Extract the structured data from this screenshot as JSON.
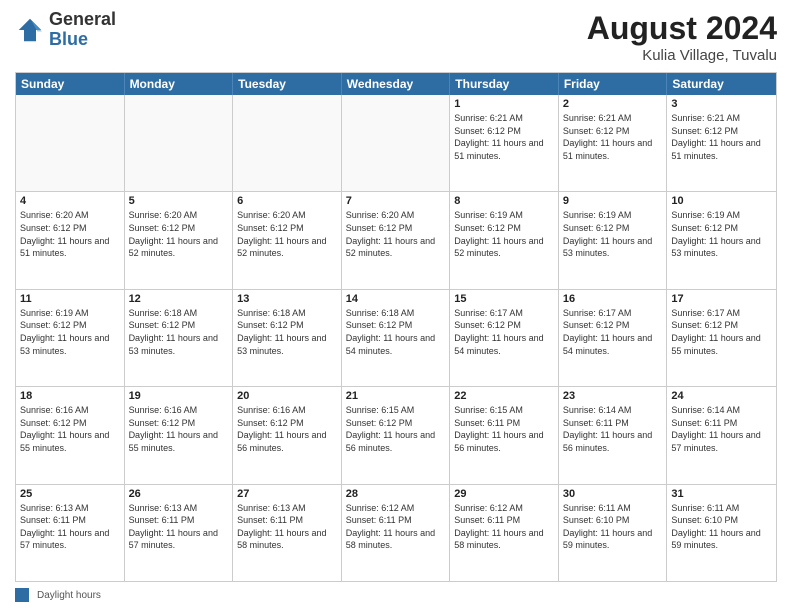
{
  "logo": {
    "general": "General",
    "blue": "Blue"
  },
  "title": "August 2024",
  "subtitle": "Kulia Village, Tuvalu",
  "days_of_week": [
    "Sunday",
    "Monday",
    "Tuesday",
    "Wednesday",
    "Thursday",
    "Friday",
    "Saturday"
  ],
  "weeks": [
    [
      {
        "day": "",
        "sunrise": "",
        "sunset": "",
        "daylight": "",
        "empty": true
      },
      {
        "day": "",
        "sunrise": "",
        "sunset": "",
        "daylight": "",
        "empty": true
      },
      {
        "day": "",
        "sunrise": "",
        "sunset": "",
        "daylight": "",
        "empty": true
      },
      {
        "day": "",
        "sunrise": "",
        "sunset": "",
        "daylight": "",
        "empty": true
      },
      {
        "day": "1",
        "sunrise": "Sunrise: 6:21 AM",
        "sunset": "Sunset: 6:12 PM",
        "daylight": "Daylight: 11 hours and 51 minutes.",
        "empty": false
      },
      {
        "day": "2",
        "sunrise": "Sunrise: 6:21 AM",
        "sunset": "Sunset: 6:12 PM",
        "daylight": "Daylight: 11 hours and 51 minutes.",
        "empty": false
      },
      {
        "day": "3",
        "sunrise": "Sunrise: 6:21 AM",
        "sunset": "Sunset: 6:12 PM",
        "daylight": "Daylight: 11 hours and 51 minutes.",
        "empty": false
      }
    ],
    [
      {
        "day": "4",
        "sunrise": "Sunrise: 6:20 AM",
        "sunset": "Sunset: 6:12 PM",
        "daylight": "Daylight: 11 hours and 51 minutes.",
        "empty": false
      },
      {
        "day": "5",
        "sunrise": "Sunrise: 6:20 AM",
        "sunset": "Sunset: 6:12 PM",
        "daylight": "Daylight: 11 hours and 52 minutes.",
        "empty": false
      },
      {
        "day": "6",
        "sunrise": "Sunrise: 6:20 AM",
        "sunset": "Sunset: 6:12 PM",
        "daylight": "Daylight: 11 hours and 52 minutes.",
        "empty": false
      },
      {
        "day": "7",
        "sunrise": "Sunrise: 6:20 AM",
        "sunset": "Sunset: 6:12 PM",
        "daylight": "Daylight: 11 hours and 52 minutes.",
        "empty": false
      },
      {
        "day": "8",
        "sunrise": "Sunrise: 6:19 AM",
        "sunset": "Sunset: 6:12 PM",
        "daylight": "Daylight: 11 hours and 52 minutes.",
        "empty": false
      },
      {
        "day": "9",
        "sunrise": "Sunrise: 6:19 AM",
        "sunset": "Sunset: 6:12 PM",
        "daylight": "Daylight: 11 hours and 53 minutes.",
        "empty": false
      },
      {
        "day": "10",
        "sunrise": "Sunrise: 6:19 AM",
        "sunset": "Sunset: 6:12 PM",
        "daylight": "Daylight: 11 hours and 53 minutes.",
        "empty": false
      }
    ],
    [
      {
        "day": "11",
        "sunrise": "Sunrise: 6:19 AM",
        "sunset": "Sunset: 6:12 PM",
        "daylight": "Daylight: 11 hours and 53 minutes.",
        "empty": false
      },
      {
        "day": "12",
        "sunrise": "Sunrise: 6:18 AM",
        "sunset": "Sunset: 6:12 PM",
        "daylight": "Daylight: 11 hours and 53 minutes.",
        "empty": false
      },
      {
        "day": "13",
        "sunrise": "Sunrise: 6:18 AM",
        "sunset": "Sunset: 6:12 PM",
        "daylight": "Daylight: 11 hours and 53 minutes.",
        "empty": false
      },
      {
        "day": "14",
        "sunrise": "Sunrise: 6:18 AM",
        "sunset": "Sunset: 6:12 PM",
        "daylight": "Daylight: 11 hours and 54 minutes.",
        "empty": false
      },
      {
        "day": "15",
        "sunrise": "Sunrise: 6:17 AM",
        "sunset": "Sunset: 6:12 PM",
        "daylight": "Daylight: 11 hours and 54 minutes.",
        "empty": false
      },
      {
        "day": "16",
        "sunrise": "Sunrise: 6:17 AM",
        "sunset": "Sunset: 6:12 PM",
        "daylight": "Daylight: 11 hours and 54 minutes.",
        "empty": false
      },
      {
        "day": "17",
        "sunrise": "Sunrise: 6:17 AM",
        "sunset": "Sunset: 6:12 PM",
        "daylight": "Daylight: 11 hours and 55 minutes.",
        "empty": false
      }
    ],
    [
      {
        "day": "18",
        "sunrise": "Sunrise: 6:16 AM",
        "sunset": "Sunset: 6:12 PM",
        "daylight": "Daylight: 11 hours and 55 minutes.",
        "empty": false
      },
      {
        "day": "19",
        "sunrise": "Sunrise: 6:16 AM",
        "sunset": "Sunset: 6:12 PM",
        "daylight": "Daylight: 11 hours and 55 minutes.",
        "empty": false
      },
      {
        "day": "20",
        "sunrise": "Sunrise: 6:16 AM",
        "sunset": "Sunset: 6:12 PM",
        "daylight": "Daylight: 11 hours and 56 minutes.",
        "empty": false
      },
      {
        "day": "21",
        "sunrise": "Sunrise: 6:15 AM",
        "sunset": "Sunset: 6:12 PM",
        "daylight": "Daylight: 11 hours and 56 minutes.",
        "empty": false
      },
      {
        "day": "22",
        "sunrise": "Sunrise: 6:15 AM",
        "sunset": "Sunset: 6:11 PM",
        "daylight": "Daylight: 11 hours and 56 minutes.",
        "empty": false
      },
      {
        "day": "23",
        "sunrise": "Sunrise: 6:14 AM",
        "sunset": "Sunset: 6:11 PM",
        "daylight": "Daylight: 11 hours and 56 minutes.",
        "empty": false
      },
      {
        "day": "24",
        "sunrise": "Sunrise: 6:14 AM",
        "sunset": "Sunset: 6:11 PM",
        "daylight": "Daylight: 11 hours and 57 minutes.",
        "empty": false
      }
    ],
    [
      {
        "day": "25",
        "sunrise": "Sunrise: 6:13 AM",
        "sunset": "Sunset: 6:11 PM",
        "daylight": "Daylight: 11 hours and 57 minutes.",
        "empty": false
      },
      {
        "day": "26",
        "sunrise": "Sunrise: 6:13 AM",
        "sunset": "Sunset: 6:11 PM",
        "daylight": "Daylight: 11 hours and 57 minutes.",
        "empty": false
      },
      {
        "day": "27",
        "sunrise": "Sunrise: 6:13 AM",
        "sunset": "Sunset: 6:11 PM",
        "daylight": "Daylight: 11 hours and 58 minutes.",
        "empty": false
      },
      {
        "day": "28",
        "sunrise": "Sunrise: 6:12 AM",
        "sunset": "Sunset: 6:11 PM",
        "daylight": "Daylight: 11 hours and 58 minutes.",
        "empty": false
      },
      {
        "day": "29",
        "sunrise": "Sunrise: 6:12 AM",
        "sunset": "Sunset: 6:11 PM",
        "daylight": "Daylight: 11 hours and 58 minutes.",
        "empty": false
      },
      {
        "day": "30",
        "sunrise": "Sunrise: 6:11 AM",
        "sunset": "Sunset: 6:10 PM",
        "daylight": "Daylight: 11 hours and 59 minutes.",
        "empty": false
      },
      {
        "day": "31",
        "sunrise": "Sunrise: 6:11 AM",
        "sunset": "Sunset: 6:10 PM",
        "daylight": "Daylight: 11 hours and 59 minutes.",
        "empty": false
      }
    ]
  ],
  "footer": {
    "label": "Daylight hours"
  }
}
